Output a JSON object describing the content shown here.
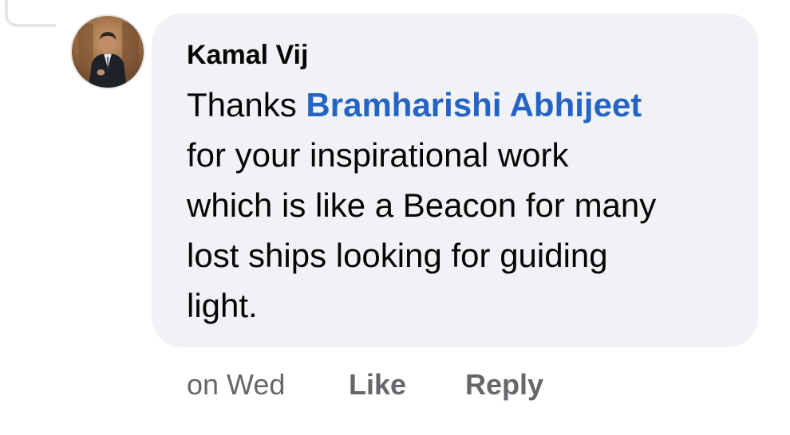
{
  "comment": {
    "author": "Kamal Vij",
    "text_before_mention": "Thanks ",
    "mention": "Bramharishi Abhijeet",
    "lines": [
      "for your inspirational work",
      "which is like a Beacon for many",
      "lost ships looking for guiding",
      "light."
    ],
    "avatar_icon": "profile-photo"
  },
  "actions": {
    "timestamp": "on Wed",
    "like_label": "Like",
    "reply_label": "Reply"
  },
  "colors": {
    "bubble_background": "#f0f2f5",
    "mention_link": "#2464c4",
    "secondary_text": "#65676b",
    "primary_text": "#050505"
  }
}
